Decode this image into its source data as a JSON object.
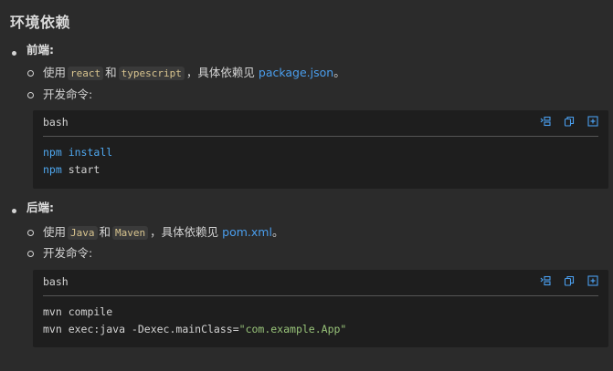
{
  "heading": "环境依赖",
  "frontend": {
    "label": "前端",
    "colon": ":",
    "usage_prefix": "使用",
    "code1": "react",
    "and": "和",
    "code2": "typescript",
    "usage_suffix": "，具体依赖见",
    "link": "package.json",
    "period": "。",
    "dev_label": "开发命令:",
    "codeblock": {
      "lang": "bash",
      "line1_cmd": "npm",
      "line1_rest": " install",
      "line2_cmd": "npm",
      "line2_rest": " start"
    }
  },
  "backend": {
    "label": "后端",
    "colon": ":",
    "usage_prefix": "使用",
    "code1": "Java",
    "and": "和",
    "code2": "Maven",
    "usage_suffix": "，具体依赖见",
    "link": "pom.xml",
    "period": "。",
    "dev_label": "开发命令:",
    "codeblock": {
      "lang": "bash",
      "line1": "mvn compile",
      "line2_prefix": "mvn exec:java -Dexec.mainClass=",
      "line2_string": "\"com.example.App\""
    }
  },
  "icons": {
    "insert": "insert-at-cursor-icon",
    "copy": "copy-icon",
    "new_file": "new-file-icon"
  },
  "colors": {
    "link": "#4a9eed",
    "keyword": "#4fa8f0",
    "string": "#98c379",
    "icon": "#4a9eed"
  }
}
